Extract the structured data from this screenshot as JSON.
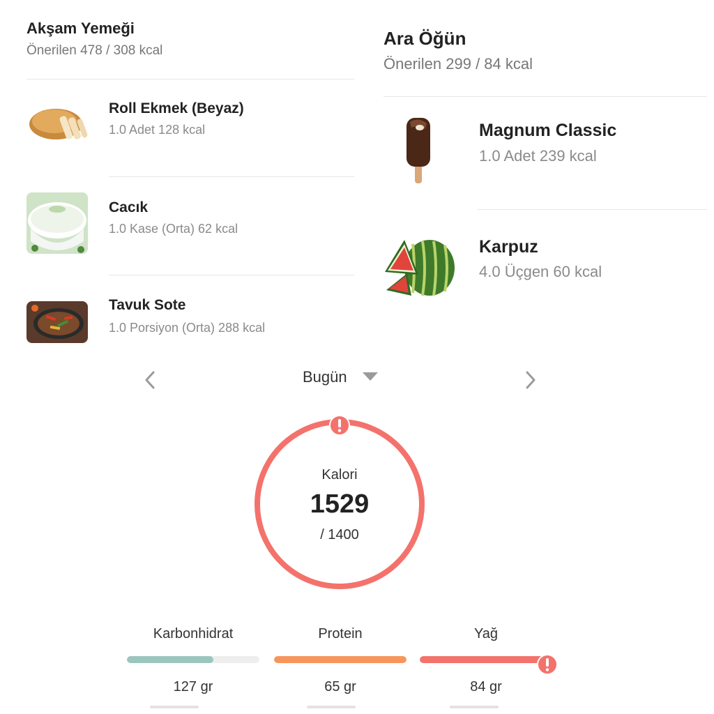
{
  "dinner": {
    "title": "Akşam Yemeği",
    "summary": "Önerilen 478 / 308 kcal",
    "items": [
      {
        "name": "Roll Ekmek (Beyaz)",
        "detail": "1.0 Adet 128 kcal",
        "icon": "bread-icon"
      },
      {
        "name": "Cacık",
        "detail": "1.0 Kase (Orta) 62 kcal",
        "icon": "cacik-bowl-icon"
      },
      {
        "name": "Tavuk Sote",
        "detail": "1.0 Porsiyon (Orta) 288 kcal",
        "icon": "chicken-saute-pan-icon"
      }
    ]
  },
  "snack": {
    "title": "Ara Öğün",
    "summary": "Önerilen 299 / 84 kcal",
    "items": [
      {
        "name": "Magnum Classic",
        "detail": "1.0 Adet 239 kcal",
        "icon": "ice-cream-bar-icon"
      },
      {
        "name": "Karpuz",
        "detail": "4.0 Üçgen 60 kcal",
        "icon": "watermelon-icon"
      }
    ]
  },
  "date_nav": {
    "label": "Bugün",
    "prev_icon": "chevron-left-icon",
    "next_icon": "chevron-right-icon",
    "dropdown_icon": "caret-down-icon"
  },
  "calorie_ring": {
    "label": "Kalori",
    "value": "1529",
    "goal": "/ 1400",
    "progress_fraction": 1.0,
    "over_limit": true,
    "warning_icon": "exclamation-warning-icon",
    "ring_color": "#f4726c"
  },
  "macros": [
    {
      "label": "Karbonhidrat",
      "value": "127 gr",
      "progress_fraction": 0.65,
      "color": "#9cc6bd",
      "over": false
    },
    {
      "label": "Protein",
      "value": "65 gr",
      "progress_fraction": 1.0,
      "color": "#f7965c",
      "over": false
    },
    {
      "label": "Yağ",
      "value": "84 gr",
      "progress_fraction": 1.0,
      "color": "#f4726c",
      "over": true
    }
  ],
  "colors": {
    "accent_red": "#f4726c",
    "carb": "#9cc6bd",
    "protein": "#f7965c",
    "fat": "#f4726c"
  }
}
